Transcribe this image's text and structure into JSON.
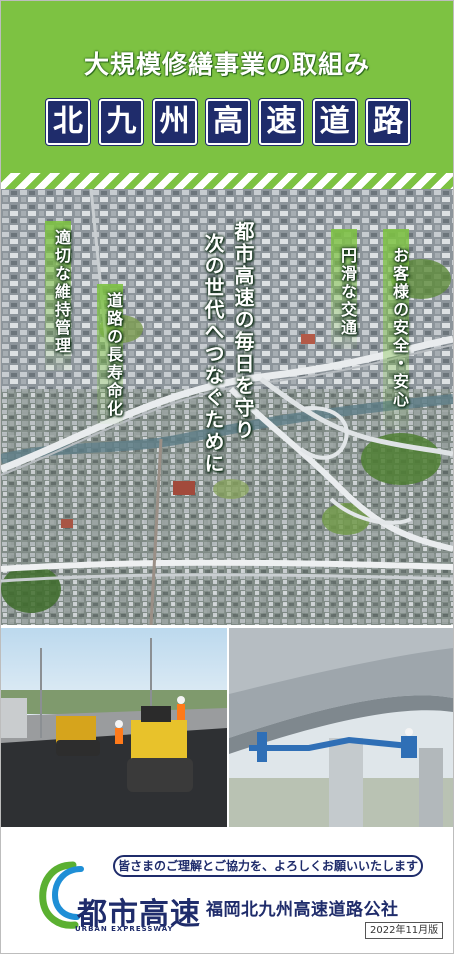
{
  "header": {
    "subtitle": "大規模修繕事業の取組み",
    "title_chars": [
      "北",
      "九",
      "州",
      "高",
      "速",
      "道",
      "路"
    ]
  },
  "messages": {
    "center_line1": "都市高速の毎日を守り",
    "center_line2": "次の世代へつなぐために",
    "left1": "適切な維持管理",
    "left2": "道路の長寿命化",
    "right1": "円滑な交通",
    "right2": "お客様の安全・安心"
  },
  "footer": {
    "banner": "皆さまのご理解とご協力を、よろしくお願いいたします",
    "logo_text": "都市高速",
    "logo_subtext": "URBAN EXPRESSWAY",
    "company": "福岡北九州高速道路公社",
    "edition": "2022年11月版"
  },
  "colors": {
    "header_green": "#7dc242",
    "navy": "#1f2c6b",
    "logo_green": "#5bb031",
    "logo_blue": "#1f8fd6"
  }
}
